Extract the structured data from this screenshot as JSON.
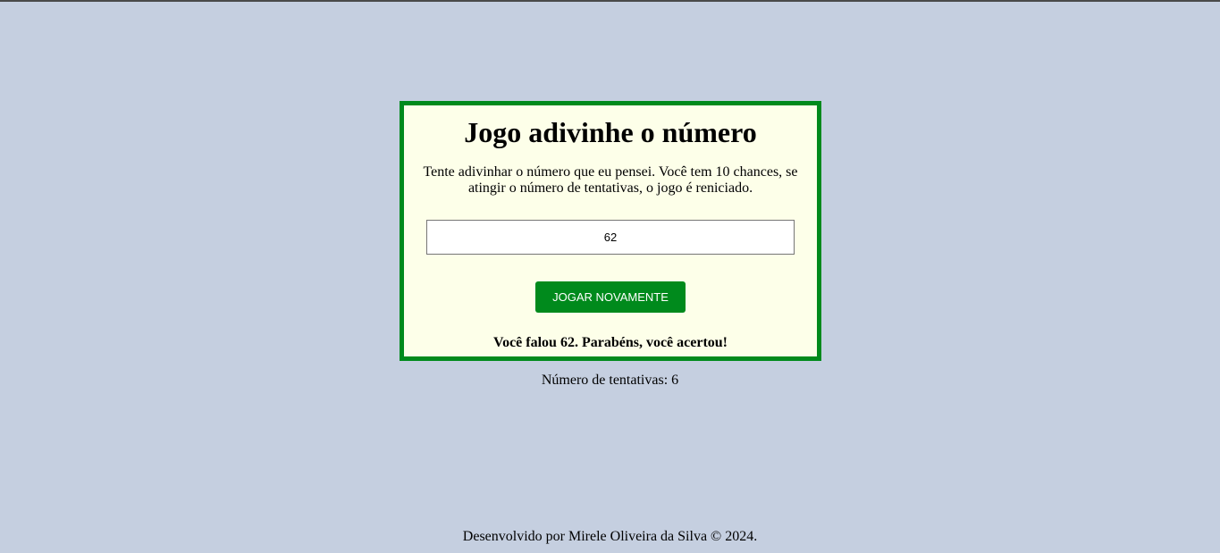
{
  "game": {
    "title": "Jogo adivinhe o número",
    "instructions": "Tente adivinhar o número que eu pensei. Você tem 10 chances, se atingir o número de tentativas, o jogo é reniciado.",
    "guess_value": "62",
    "play_again_label": "JOGAR NOVAMENTE",
    "result_message": "Você falou 62. Parabéns, você acertou!"
  },
  "attempts": {
    "label": "Número de tentativas:",
    "value": "6"
  },
  "footer": {
    "text": "Desenvolvido por Mirele Oliveira da Silva © 2024."
  },
  "colors": {
    "background": "#c5cfe0",
    "box_background": "#fdffe9",
    "accent_green": "#008a1c"
  }
}
